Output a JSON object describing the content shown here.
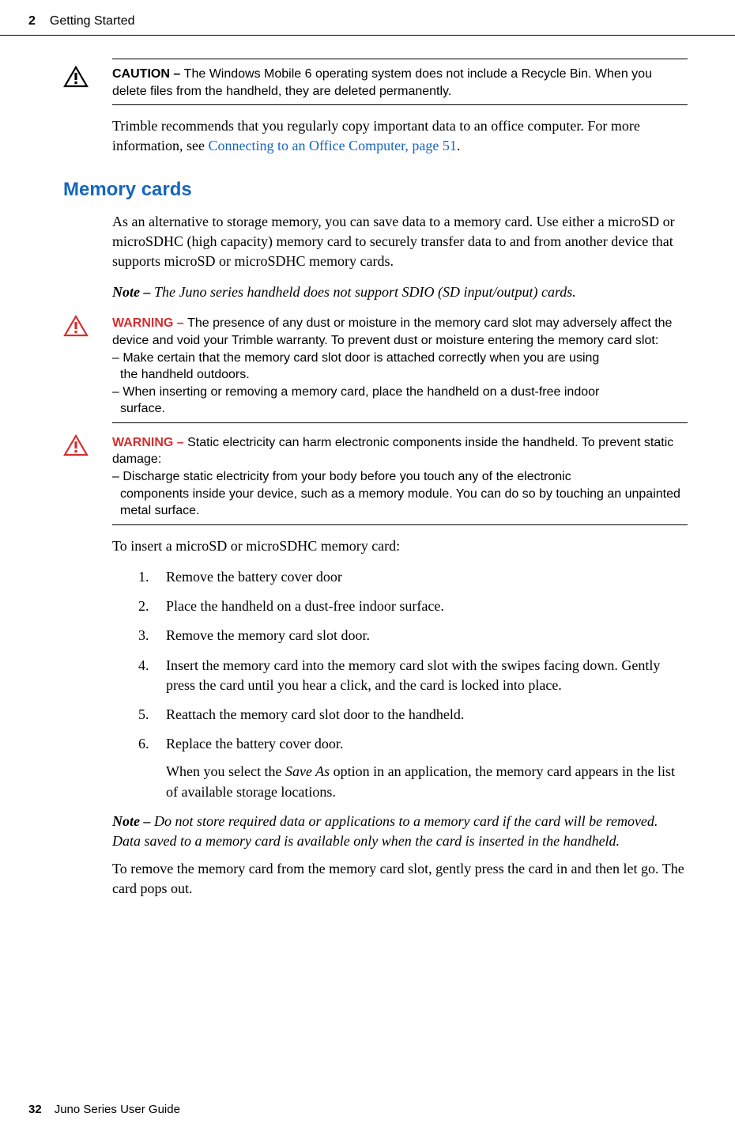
{
  "header": {
    "chapter_number": "2",
    "chapter_title": "Getting Started"
  },
  "caution": {
    "label": "CAUTION – ",
    "text": "The Windows Mobile 6 operating system does not include a Recycle Bin. When you delete files from the handheld, they are deleted permanently."
  },
  "para1_a": "Trimble recommends that you regularly copy important data to an office computer. For more information, see ",
  "para1_link": "Connecting to an Office Computer, page 51",
  "para1_b": ".",
  "heading": "Memory cards",
  "para2": "As an alternative to storage memory, you can save data to a memory card. Use either a microSD or  microSDHC (high capacity) memory card to securely transfer data to and from another device that supports microSD or microSDHC memory cards.",
  "note1_label": "Note – ",
  "note1_text": "The Juno series handheld does not support SDIO (SD input/output) cards.",
  "warning1": {
    "label": "WARNING – ",
    "text": "The presence of any dust or moisture in the memory card slot may adversely affect the device and void your Trimble warranty. To prevent dust or moisture entering the memory card slot:",
    "bullet1a": "– Make certain that the memory card slot door is attached correctly when you are using",
    "bullet1b": "the handheld outdoors.",
    "bullet2a": "– When inserting or removing a memory card, place the handheld on a dust-free indoor",
    "bullet2b": "surface."
  },
  "warning2": {
    "label": "WARNING – ",
    "text": "Static electricity can harm electronic components inside the handheld. To prevent static damage:",
    "bullet1a": "– Discharge static electricity from your body before you touch any of the electronic",
    "bullet1b": "components inside your device, such as a memory module. You can do so by touching an unpainted metal surface."
  },
  "para3": "To insert a microSD or microSDHC memory card:",
  "steps": [
    "Remove the battery cover door",
    "Place the handheld on a dust-free indoor surface.",
    "Remove the memory card slot door.",
    "Insert the memory card into the memory card slot with the swipes facing down. Gently press the card until you hear a click, and the card is locked into place.",
    "Reattach the memory card slot door to the handheld.",
    "Replace the battery cover door."
  ],
  "step6_sub_a": "When you select the ",
  "step6_sub_italic": "Save As",
  "step6_sub_b": " option in an application, the memory card appears in the list of available storage locations.",
  "note2_label": "Note – ",
  "note2_text": "Do not store required data or applications to a memory card if the card will be removed. Data saved to a memory card is available only when the card is inserted in the handheld.",
  "para4": "To remove the memory card from the memory card slot, gently press the card in and then let go. The card pops out.",
  "footer": {
    "page": "32",
    "title": "Juno Series User Guide"
  }
}
